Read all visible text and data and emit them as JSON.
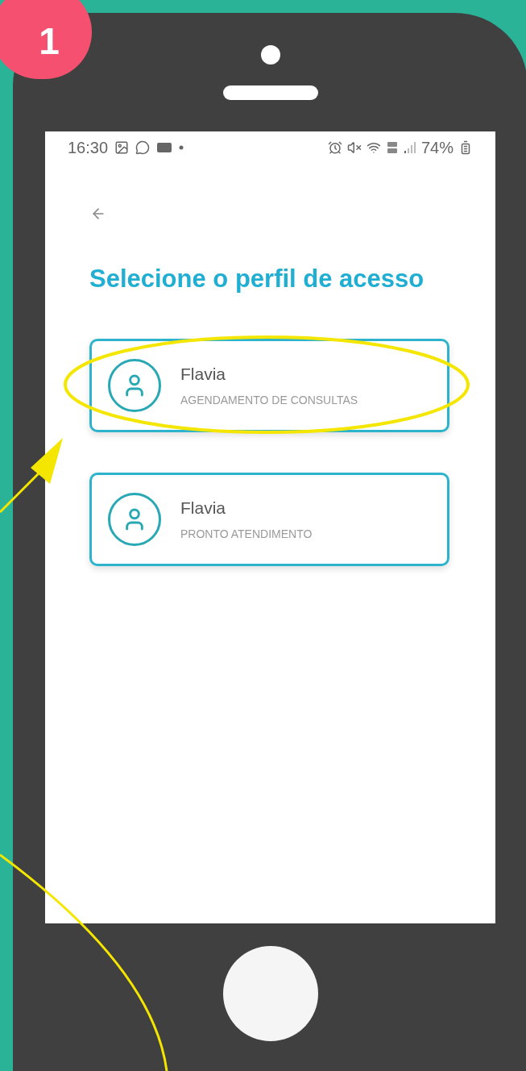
{
  "step_badge": "1",
  "status_bar": {
    "time": "16:30",
    "battery": "74%"
  },
  "title": "Selecione o perfil de acesso",
  "profiles": [
    {
      "name": "Flavia",
      "role": "AGENDAMENTO DE CONSULTAS",
      "highlighted": true
    },
    {
      "name": "Flavia",
      "role": "PRONTO ATENDIMENTO",
      "highlighted": false
    }
  ]
}
